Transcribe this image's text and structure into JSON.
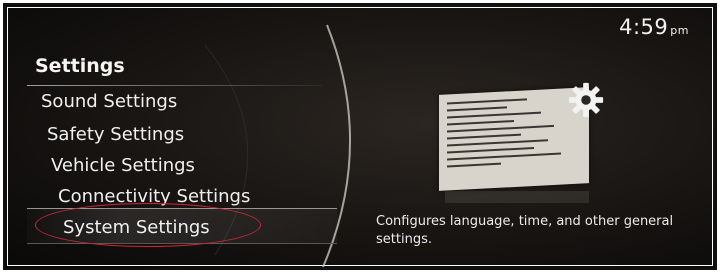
{
  "status_bar": {
    "time": "4:59",
    "ampm": "pm"
  },
  "menu": {
    "title": "Settings",
    "items": [
      {
        "label": "Sound Settings"
      },
      {
        "label": "Safety Settings"
      },
      {
        "label": "Vehicle Settings"
      },
      {
        "label": "Connectivity Settings"
      },
      {
        "label": "System Settings",
        "selected": true
      }
    ]
  },
  "detail": {
    "icon": "gear-icon",
    "description": "Configures language, time, and other general settings."
  },
  "colors": {
    "background": "#171412",
    "text": "#f0f0f0",
    "annotation_circle": "#d0263a"
  }
}
